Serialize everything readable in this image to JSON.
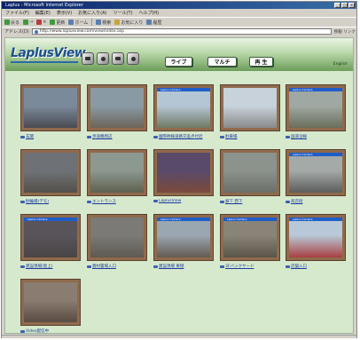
{
  "window": {
    "title": "Laplus - Microsoft Internet Explorer",
    "controls": [
      "_",
      "□",
      "×"
    ]
  },
  "menu": [
    "ファイル(F)",
    "編集(E)",
    "表示(V)",
    "お気に入り(A)",
    "ツール(T)",
    "ヘルプ(H)"
  ],
  "toolbar": {
    "back_label": "戻る",
    "forward_label": "→",
    "stop_label": "×",
    "refresh_label": "更新",
    "home_label": "ホーム",
    "search_label": "検索",
    "favorites_label": "お気に入り",
    "history_label": "履歴"
  },
  "address": {
    "label": "アドレス(D)",
    "url": "http://www.laplusview.com/view/index.asp",
    "go_label": "移動 リンク"
  },
  "header": {
    "logo": "LaplusView",
    "buttons": {
      "live": "ライブ",
      "multi": "マルチ",
      "replay": "再 生"
    },
    "lang_link": "English"
  },
  "cameras": [
    {
      "label": "玄関",
      "bar": "",
      "sky": "#7a8a9a",
      "ground": "#4a4a52"
    },
    {
      "label": "歩道橋周辺",
      "bar": "",
      "sky": "#8a9aa4",
      "ground": "#6c6458"
    },
    {
      "label": "國際幹線道路交差点付近",
      "bar": "Laplus Camera",
      "sky": "#b4c6d4",
      "ground": "#6f7a66"
    },
    {
      "label": "駐車場",
      "bar": "",
      "sky": "#c8d2da",
      "ground": "#8a8a8a"
    },
    {
      "label": "国道沿線",
      "bar": "Laplus Camera",
      "sky": "#9fa8a2",
      "ground": "#6a6e5c"
    },
    {
      "label": "駐輪場(デモ)",
      "bar": "",
      "sky": "#6e7276",
      "ground": "#55504a"
    },
    {
      "label": "エントランス",
      "bar": "",
      "sky": "#8d9890",
      "ground": "#5e6050"
    },
    {
      "label": "LaplusView",
      "bar": "",
      "sky": "#5a4a6a",
      "ground": "#7a4a3a"
    },
    {
      "label": "廊下 西下",
      "bar": "",
      "sky": "#8c928c",
      "ground": "#6a6f68"
    },
    {
      "label": "商店街",
      "bar": "Laplus Camera",
      "sky": "#a4aaa8",
      "ground": "#5c5c5c"
    },
    {
      "label": "建設現場(屋上)",
      "bar": "Laplus Camera",
      "sky": "#58545a",
      "ground": "#4a4444"
    },
    {
      "label": "資材置場入口",
      "bar": "",
      "sky": "#7b7a76",
      "ground": "#5f5a52"
    },
    {
      "label": "建設現場 東側",
      "bar": "Laplus Camera",
      "sky": "#9aa6b0",
      "ground": "#645a52"
    },
    {
      "label": "3Fバックヤード",
      "bar": "Laplus Camera",
      "sky": "#8a8478",
      "ground": "#5a544a"
    },
    {
      "label": "店舗入口",
      "bar": "Laplus Camera",
      "sky": "#b8c8d8",
      "ground": "#a84040"
    },
    {
      "label": "Video配信中",
      "bar": "",
      "sky": "#8a7c70",
      "ground": "#5a4c44"
    }
  ]
}
